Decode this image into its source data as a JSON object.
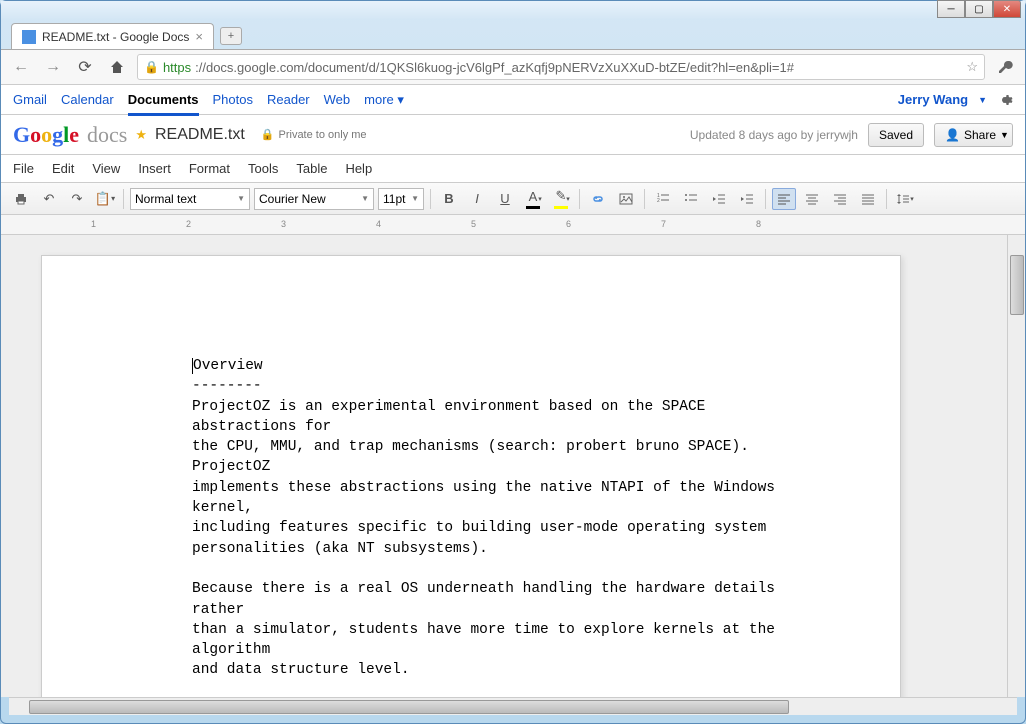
{
  "window": {
    "tab_title": "README.txt - Google Docs"
  },
  "browser": {
    "url_scheme": "https",
    "url_rest": "://docs.google.com/document/d/1QKSl6kuog-jcV6lgPf_azKqfj9pNERVzXuXXuD-btZE/edit?hl=en&pli=1#"
  },
  "services": {
    "items": [
      "Gmail",
      "Calendar",
      "Documents",
      "Photos",
      "Reader",
      "Web"
    ],
    "more": "more",
    "user": "Jerry Wang"
  },
  "doc": {
    "title": "README.txt",
    "privacy": "Private to only me",
    "updated": "Updated 8 days ago by jerrywjh",
    "saved": "Saved",
    "share": "Share"
  },
  "menus": [
    "File",
    "Edit",
    "View",
    "Insert",
    "Format",
    "Tools",
    "Table",
    "Help"
  ],
  "toolbar": {
    "style": "Normal text",
    "font": "Courier New",
    "size": "11pt"
  },
  "content": {
    "lines": [
      "Overview",
      "--------",
      "ProjectOZ is an experimental environment based on the SPACE abstractions for",
      "the CPU, MMU, and trap mechanisms (search: probert bruno SPACE).  ProjectOZ",
      "implements these abstractions using the native NTAPI of the Windows kernel,",
      "including features specific to building user-mode operating system",
      "personalities (aka NT subsystems).",
      "",
      "Because there is a real OS underneath handling the hardware details rather",
      "than a simulator, students have more time to explore kernels at the algorithm",
      "and data structure level."
    ]
  }
}
